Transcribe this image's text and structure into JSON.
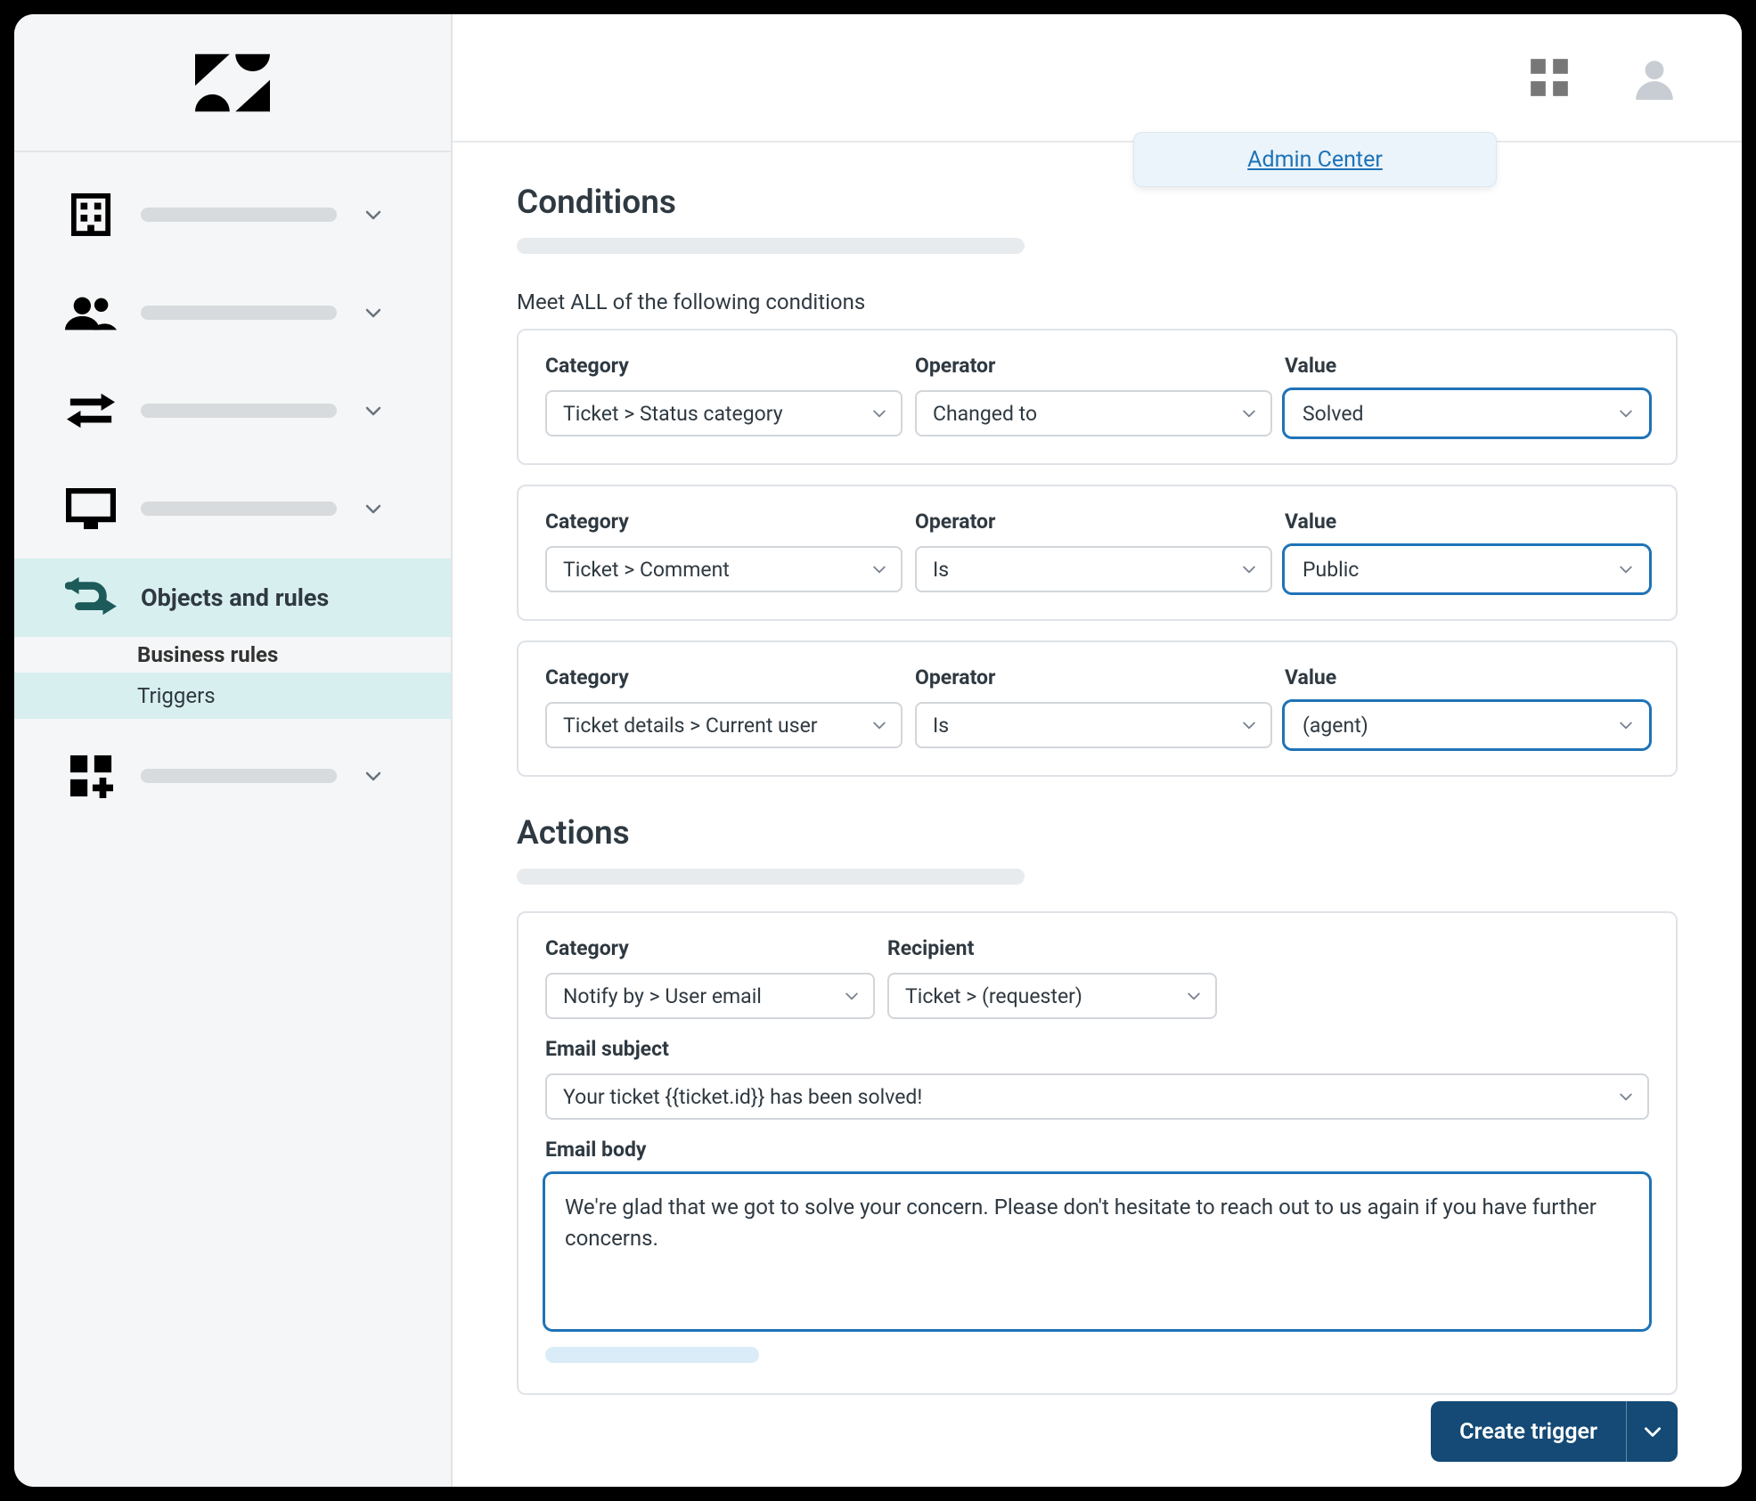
{
  "header": {
    "admin_center_label": "Admin Center"
  },
  "sidebar": {
    "active_label": "Objects and rules",
    "sub_heading": "Business rules",
    "sub_item": "Triggers"
  },
  "sections": {
    "conditions_title": "Conditions",
    "conditions_help": "Meet ALL of the following conditions",
    "actions_title": "Actions"
  },
  "labels": {
    "category": "Category",
    "operator": "Operator",
    "value": "Value",
    "recipient": "Recipient",
    "email_subject": "Email subject",
    "email_body": "Email body"
  },
  "conditions": [
    {
      "category": "Ticket > Status category",
      "operator": "Changed to",
      "value": "Solved"
    },
    {
      "category": "Ticket > Comment",
      "operator": "Is",
      "value": "Public"
    },
    {
      "category": "Ticket details > Current user",
      "operator": "Is",
      "value": "(agent)"
    }
  ],
  "action": {
    "category": "Notify by > User email",
    "recipient": "Ticket > (requester)",
    "email_subject": "Your ticket {{ticket.id}} has been solved!",
    "email_body": "We're glad that we got to solve your concern. Please don't hesitate to reach out to us again if you have further concerns."
  },
  "footer": {
    "create_trigger": "Create trigger"
  }
}
